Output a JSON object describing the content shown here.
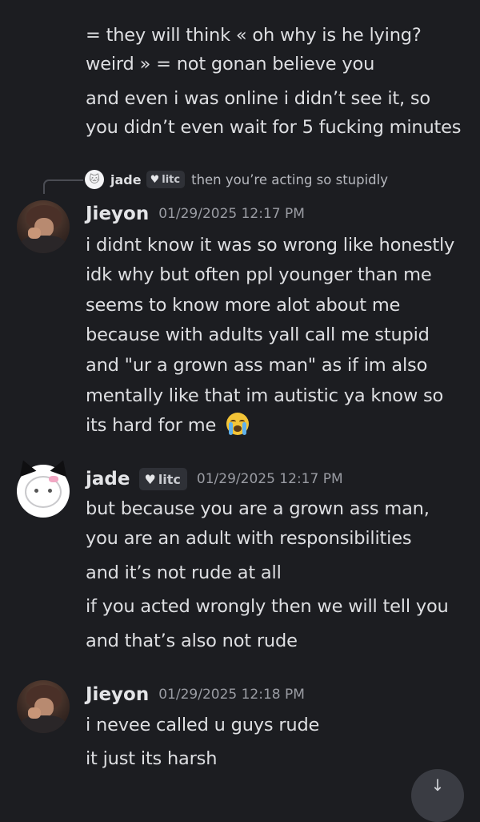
{
  "previous_message": {
    "lines": [
      "= they will think « oh why is he lying?",
      "weird » = not gonan believe you",
      "and even i was online i didn’t see it, so",
      "you didn’t even wait for 5 fucking minutes"
    ]
  },
  "messages": [
    {
      "reply": {
        "name": "jade",
        "tag": "litc",
        "text": "then you’re acting so stupidly"
      },
      "author": "Jieyon",
      "timestamp": "01/29/2025 12:17 PM",
      "lines": [
        "i didnt know it was so wrong like honestly",
        "idk why but often ppl younger than me",
        "seems to know more alot about me",
        "because with adults yall call me stupid",
        "and \"ur a grown ass man\" as if im also",
        "mentally like that im autistic ya know so",
        "its hard for me"
      ],
      "emoji": "loudly-crying-face"
    },
    {
      "author": "jade",
      "tag": "litc",
      "timestamp": "01/29/2025 12:17 PM",
      "lines": [
        "but because you are a grown ass man,",
        "you are an adult with responsibilities",
        "and it’s not rude at all",
        "if you acted wrongly then we will tell you",
        "and that’s also not rude"
      ]
    },
    {
      "author": "Jieyon",
      "timestamp": "01/29/2025 12:18 PM",
      "lines": [
        "i nevee called u guys rude",
        "it just its harsh"
      ]
    }
  ],
  "icons": {
    "heart": "♥",
    "scroll": "↓"
  },
  "colors": {
    "background": "#1c1d21",
    "text": "#dedfe2",
    "timestamp": "#9a9ca3",
    "tag_bg": "#2f3137"
  }
}
